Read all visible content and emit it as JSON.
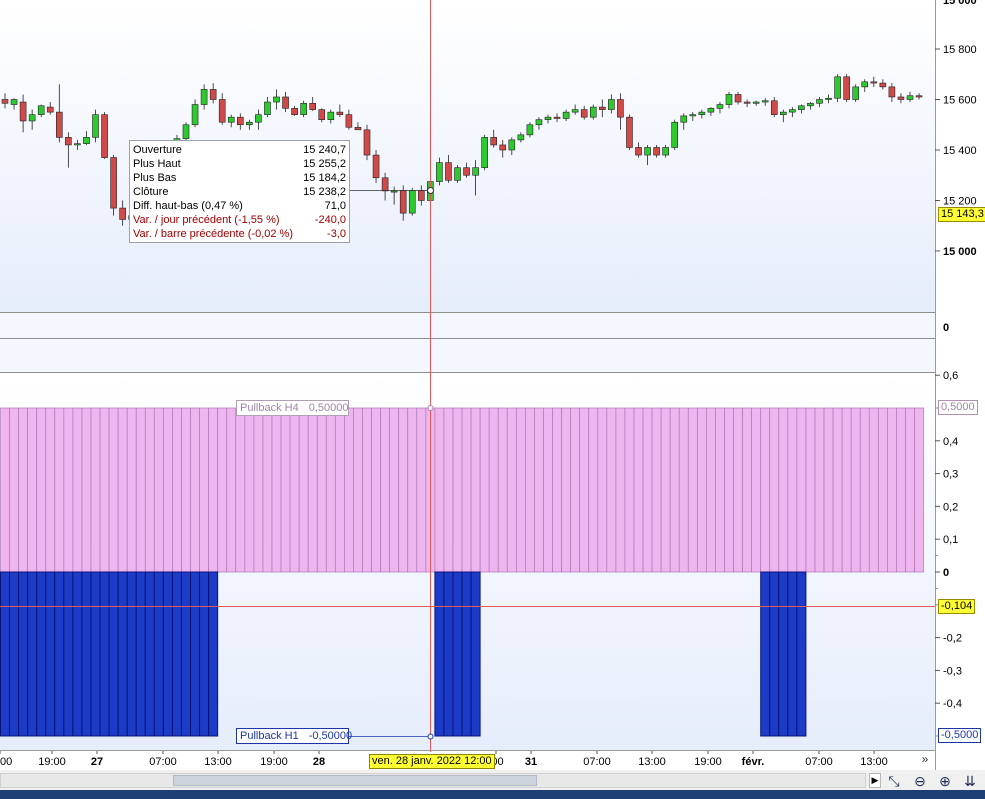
{
  "price_axis": {
    "ticks": [
      "15 800",
      "15 600",
      "15 400",
      "15 200",
      "15 000"
    ],
    "top_partial": "15 000",
    "last_price": "15 143,3",
    "range": [
      14800,
      16000
    ]
  },
  "mid_panel": {
    "zero_label": "0"
  },
  "indicator_axis": {
    "ticks": [
      "0,6",
      "0,4",
      "0,3",
      "0,2",
      "0,1",
      "0",
      "-0,2",
      "-0,3",
      "-0,4"
    ],
    "cursor_value": "-0,104",
    "h4_value": "0,5000",
    "h1_value": "-0,5000"
  },
  "time_axis": {
    "labels": [
      {
        "text": "00",
        "bold": false
      },
      {
        "text": "19:00",
        "bold": false
      },
      {
        "text": "27",
        "bold": true
      },
      {
        "text": "07:00",
        "bold": false
      },
      {
        "text": "13:00",
        "bold": false
      },
      {
        "text": "19:00",
        "bold": false
      },
      {
        "text": "28",
        "bold": true
      },
      {
        "text": ":00",
        "bold": false
      },
      {
        "text": "31",
        "bold": true
      },
      {
        "text": "07:00",
        "bold": false
      },
      {
        "text": "13:00",
        "bold": false
      },
      {
        "text": "19:00",
        "bold": false
      },
      {
        "text": "févr.",
        "bold": true
      },
      {
        "text": "07:00",
        "bold": false
      },
      {
        "text": "13:00",
        "bold": false
      }
    ],
    "cursor_date": "ven. 28 janv. 2022 12:00"
  },
  "tooltip": {
    "rows": [
      {
        "label": "Ouverture",
        "value": "15 240,7",
        "red": false
      },
      {
        "label": "Plus Haut",
        "value": "15 255,2",
        "red": false
      },
      {
        "label": "Plus Bas",
        "value": "15 184,2",
        "red": false
      },
      {
        "label": "Clôture",
        "value": "15 238,2",
        "red": false
      },
      {
        "label": "Diff. haut-bas (0,47 %)",
        "value": "71,0",
        "red": false
      },
      {
        "label": "Var. / jour précédent (-1,55 %)",
        "value": "-240,0",
        "red": true
      },
      {
        "label": "Var. / barre précédente (-0,02 %)",
        "value": "-3,0",
        "red": true
      }
    ]
  },
  "indicators": {
    "h4": {
      "name": "Pullback H4",
      "value": "0,50000"
    },
    "h1": {
      "name": "Pullback H1",
      "value": "-0,50000"
    }
  },
  "candles": [
    [
      15600,
      15625,
      15565,
      15585
    ],
    [
      15580,
      15605,
      15560,
      15600
    ],
    [
      15590,
      15620,
      15470,
      15515
    ],
    [
      15515,
      15560,
      15480,
      15540
    ],
    [
      15540,
      15580,
      15530,
      15575
    ],
    [
      15570,
      15590,
      15540,
      15550
    ],
    [
      15550,
      15660,
      15430,
      15450
    ],
    [
      15450,
      15470,
      15330,
      15420
    ],
    [
      15420,
      15440,
      15400,
      15425
    ],
    [
      15425,
      15475,
      15420,
      15450
    ],
    [
      15450,
      15560,
      15430,
      15540
    ],
    [
      15540,
      15550,
      15365,
      15370
    ],
    [
      15370,
      15380,
      15140,
      15170
    ],
    [
      15170,
      15200,
      15100,
      15125
    ],
    [
      15125,
      15160,
      15110,
      15140
    ],
    [
      15140,
      15220,
      15130,
      15210
    ],
    [
      15210,
      15330,
      15200,
      15320
    ],
    [
      15320,
      15360,
      15300,
      15355
    ],
    [
      15355,
      15420,
      15340,
      15400
    ],
    [
      15400,
      15460,
      15390,
      15445
    ],
    [
      15445,
      15510,
      15430,
      15500
    ],
    [
      15500,
      15600,
      15490,
      15580
    ],
    [
      15580,
      15660,
      15560,
      15640
    ],
    [
      15640,
      15665,
      15585,
      15600
    ],
    [
      15600,
      15625,
      15500,
      15510
    ],
    [
      15510,
      15540,
      15490,
      15530
    ],
    [
      15530,
      15545,
      15480,
      15500
    ],
    [
      15500,
      15520,
      15480,
      15510
    ],
    [
      15510,
      15560,
      15480,
      15540
    ],
    [
      15540,
      15610,
      15530,
      15590
    ],
    [
      15590,
      15640,
      15560,
      15610
    ],
    [
      15610,
      15630,
      15550,
      15565
    ],
    [
      15565,
      15575,
      15535,
      15540
    ],
    [
      15540,
      15595,
      15530,
      15585
    ],
    [
      15585,
      15610,
      15555,
      15560
    ],
    [
      15560,
      15565,
      15510,
      15520
    ],
    [
      15520,
      15560,
      15505,
      15550
    ],
    [
      15550,
      15580,
      15530,
      15540
    ],
    [
      15540,
      15560,
      15480,
      15490
    ],
    [
      15490,
      15510,
      15480,
      15480
    ],
    [
      15480,
      15500,
      15360,
      15380
    ],
    [
      15380,
      15400,
      15270,
      15290
    ],
    [
      15290,
      15310,
      15200,
      15238
    ],
    [
      15238,
      15255,
      15184,
      15238
    ],
    [
      15240,
      15260,
      15120,
      15150
    ],
    [
      15150,
      15250,
      15140,
      15240
    ],
    [
      15240,
      15260,
      15180,
      15200
    ],
    [
      15200,
      15280,
      15195,
      15275
    ],
    [
      15275,
      15370,
      15260,
      15350
    ],
    [
      15350,
      15380,
      15270,
      15280
    ],
    [
      15280,
      15340,
      15270,
      15330
    ],
    [
      15330,
      15350,
      15290,
      15300
    ],
    [
      15300,
      15360,
      15220,
      15330
    ],
    [
      15330,
      15460,
      15320,
      15450
    ],
    [
      15450,
      15480,
      15410,
      15420
    ],
    [
      15420,
      15440,
      15370,
      15400
    ],
    [
      15400,
      15450,
      15380,
      15440
    ],
    [
      15440,
      15470,
      15430,
      15460
    ],
    [
      15460,
      15510,
      15450,
      15500
    ],
    [
      15500,
      15530,
      15480,
      15520
    ],
    [
      15520,
      15540,
      15505,
      15530
    ],
    [
      15530,
      15545,
      15510,
      15525
    ],
    [
      15525,
      15560,
      15515,
      15550
    ],
    [
      15550,
      15580,
      15540,
      15560
    ],
    [
      15560,
      15575,
      15520,
      15530
    ],
    [
      15530,
      15580,
      15520,
      15570
    ],
    [
      15570,
      15600,
      15530,
      15560
    ],
    [
      15560,
      15620,
      15545,
      15600
    ],
    [
      15600,
      15625,
      15480,
      15530
    ],
    [
      15530,
      15540,
      15400,
      15410
    ],
    [
      15410,
      15430,
      15370,
      15380
    ],
    [
      15380,
      15420,
      15340,
      15410
    ],
    [
      15410,
      15420,
      15370,
      15380
    ],
    [
      15380,
      15420,
      15370,
      15410
    ],
    [
      15410,
      15520,
      15400,
      15510
    ],
    [
      15510,
      15545,
      15480,
      15535
    ],
    [
      15535,
      15550,
      15515,
      15540
    ],
    [
      15540,
      15560,
      15525,
      15550
    ],
    [
      15550,
      15570,
      15535,
      15565
    ],
    [
      15565,
      15590,
      15545,
      15580
    ],
    [
      15580,
      15630,
      15565,
      15620
    ],
    [
      15620,
      15630,
      15580,
      15590
    ],
    [
      15590,
      15600,
      15570,
      15585
    ],
    [
      15585,
      15595,
      15575,
      15590
    ],
    [
      15590,
      15605,
      15575,
      15595
    ],
    [
      15595,
      15610,
      15530,
      15540
    ],
    [
      15540,
      15560,
      15510,
      15550
    ],
    [
      15550,
      15570,
      15530,
      15560
    ],
    [
      15560,
      15580,
      15545,
      15575
    ],
    [
      15575,
      15590,
      15560,
      15585
    ],
    [
      15585,
      15610,
      15570,
      15600
    ],
    [
      15600,
      15620,
      15585,
      15605
    ],
    [
      15605,
      15700,
      15590,
      15690
    ],
    [
      15690,
      15700,
      15590,
      15600
    ],
    [
      15600,
      15660,
      15590,
      15650
    ],
    [
      15650,
      15680,
      15630,
      15670
    ],
    [
      15670,
      15690,
      15650,
      15665
    ],
    [
      15665,
      15680,
      15640,
      15650
    ],
    [
      15650,
      15665,
      15590,
      15610
    ],
    [
      15610,
      15625,
      15585,
      15600
    ],
    [
      15600,
      15630,
      15590,
      15615
    ],
    [
      15615,
      15625,
      15600,
      15610
    ]
  ],
  "pullback_h4": {
    "value": 0.5,
    "bars": 102
  },
  "pullback_h1_blocks": [
    {
      "from_bar": 0,
      "to_bar": 23,
      "value": -0.5
    },
    {
      "from_bar": 48,
      "to_bar": 52,
      "value": -0.5
    },
    {
      "from_bar": 84,
      "to_bar": 88,
      "value": -0.5
    }
  ],
  "colors": {
    "up": "#2ec92e",
    "down": "#d04a4a",
    "h4_fill": "#eeb5ee",
    "h4_stroke": "#b07ab8",
    "h1_fill": "#1c3cc8",
    "h1_stroke": "#08157a",
    "cursor": "#e05a5a"
  }
}
